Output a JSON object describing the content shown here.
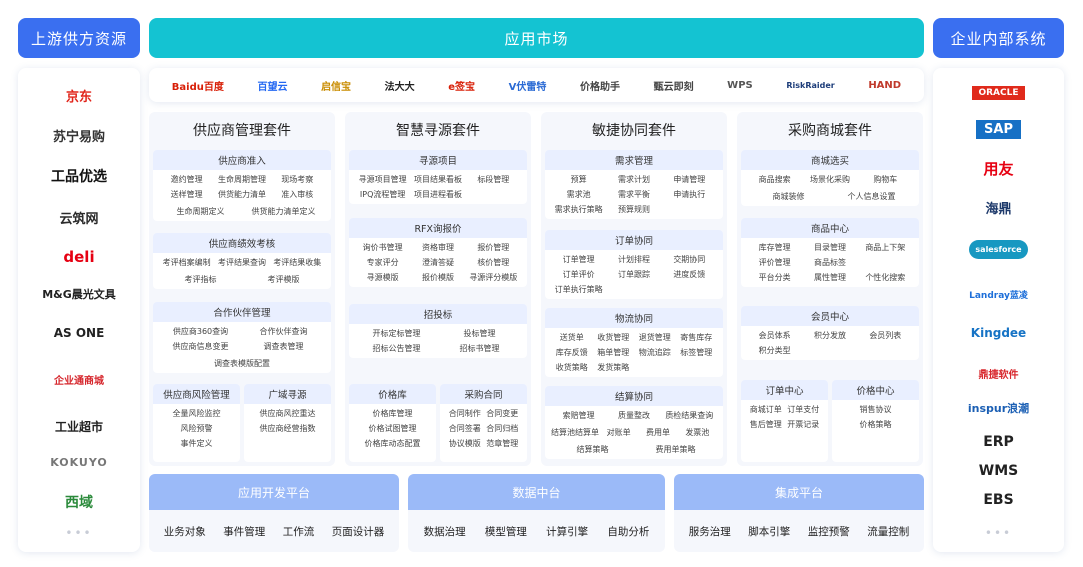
{
  "headers": {
    "left": "上游供方资源",
    "center": "应用市场",
    "right": "企业内部系统"
  },
  "left_logos": [
    "京东",
    "苏宁易购",
    "工品优选",
    "云筑网",
    "deli",
    "M&G晨光文具",
    "AS ONE",
    "企业通商城",
    "工业超市",
    "KOKUYO",
    "西域"
  ],
  "right_logos": [
    "ORACLE",
    "SAP",
    "用友",
    "海鼎",
    "salesforce",
    "Landray蓝凌",
    "Kingdee",
    "鼎捷软件",
    "inspur浪潮",
    "ERP",
    "WMS",
    "EBS"
  ],
  "logobar": [
    "Baidu百度",
    "百望云",
    "启信宝",
    "法大大",
    "e签宝",
    "V伏雷特",
    "价格助手",
    "甄云即刻",
    "WPS",
    "RiskRaider",
    "HAND"
  ],
  "dots": "•••",
  "suites": [
    {
      "title": "供应商管理套件",
      "sections": [
        {
          "h": "供应商准入",
          "items": [
            "邀约管理",
            "生命周期管理",
            "现场考察",
            "送样管理",
            "供货能力清单",
            "准入审核",
            "生命周期定义",
            "供货能力清单定义"
          ]
        },
        {
          "h": "供应商绩效考核",
          "items": [
            "考评档案编制",
            "考评结果查询",
            "考评结果收集",
            "考评指标",
            "考评模版"
          ]
        },
        {
          "h": "合作伙伴管理",
          "items": [
            "供应商360查询",
            "合作伙伴查询",
            "供应商信息变更",
            "调查表管理",
            "调查表模版配置"
          ]
        }
      ],
      "halves": [
        {
          "h": "供应商风险管理",
          "items": [
            "全量风险监控",
            "风险预警",
            "事件定义"
          ]
        },
        {
          "h": "广域寻源",
          "items": [
            "供应商风控重达",
            "供应商经营指数"
          ]
        }
      ]
    },
    {
      "title": "智慧寻源套件",
      "sections": [
        {
          "h": "寻源项目",
          "items": [
            "寻源项目管理",
            "项目结果看板",
            "标段管理",
            "IPQ流程管理",
            "项目进程看板"
          ]
        },
        {
          "h": "RFX询报价",
          "items": [
            "询价书管理",
            "资格审理",
            "报价管理",
            "专家评分",
            "澄清答疑",
            "核价管理",
            "寻源模版",
            "报价模版",
            "寻源评分模版"
          ]
        },
        {
          "h": "招投标",
          "items": [
            "开标定标管理",
            "投标管理",
            "招标公告管理",
            "招标书管理"
          ]
        }
      ],
      "halves": [
        {
          "h": "价格库",
          "items": [
            "价格库管理",
            "价格试图管理",
            "价格库动态配置"
          ]
        },
        {
          "h": "采购合同",
          "items": [
            "合同制作",
            "合同变更",
            "合同签署",
            "合同归档",
            "协议模版",
            "范章管理"
          ]
        }
      ]
    },
    {
      "title": "敏捷协同套件",
      "sections": [
        {
          "h": "需求管理",
          "items": [
            "预算",
            "需求计划",
            "申请管理",
            "需求池",
            "需求平衡",
            "申请执行",
            "需求执行策略",
            "预算规则"
          ]
        },
        {
          "h": "订单协同",
          "items": [
            "订单管理",
            "计划排程",
            "交期协同",
            "订单评价",
            "订单跟踪",
            "进度反馈",
            "订单执行策略"
          ]
        },
        {
          "h": "物流协同",
          "items": [
            "送货单",
            "收货管理",
            "退货管理",
            "寄售库存",
            "库存反馈",
            "箱单管理",
            "物流追踪",
            "标签管理",
            "收货策略",
            "发货策略"
          ]
        },
        {
          "h": "结算协同",
          "items": [
            "索赔管理",
            "质量整改",
            "质检结果查询",
            "结算池结算单",
            "对账单",
            "费用单",
            "发票池",
            "结算策略",
            "费用单策略"
          ]
        }
      ]
    },
    {
      "title": "采购商城套件",
      "sections": [
        {
          "h": "商城选买",
          "items": [
            "商品搜索",
            "场景化采购",
            "购物车",
            "商城装修",
            "个人信息设置"
          ]
        },
        {
          "h": "商品中心",
          "items": [
            "库存管理",
            "目录管理",
            "商品上下架",
            "评价管理",
            "商品标签",
            "平台分类",
            "属性管理",
            "个性化搜索"
          ]
        },
        {
          "h": "会员中心",
          "items": [
            "会员体系",
            "积分发放",
            "会员列表",
            "积分类型"
          ]
        }
      ],
      "halves": [
        {
          "h": "订单中心",
          "items": [
            "商城订单",
            "订单支付",
            "售后管理",
            "开票记录"
          ]
        },
        {
          "h": "价格中心",
          "items": [
            "销售协议",
            "价格策略"
          ]
        }
      ]
    }
  ],
  "platforms": [
    {
      "h": "应用开发平台",
      "items": [
        "业务对象",
        "事件管理",
        "工作流",
        "页面设计器"
      ]
    },
    {
      "h": "数据中台",
      "items": [
        "数据治理",
        "模型管理",
        "计算引擎",
        "自助分析"
      ]
    },
    {
      "h": "集成平台",
      "items": [
        "服务治理",
        "脚本引擎",
        "监控预警",
        "流量控制"
      ]
    }
  ],
  "colors": {
    "blue": "#3a6ff0",
    "teal": "#14c3d2",
    "section_header": "#e9efff",
    "platform_header": "#9bbaf8"
  }
}
